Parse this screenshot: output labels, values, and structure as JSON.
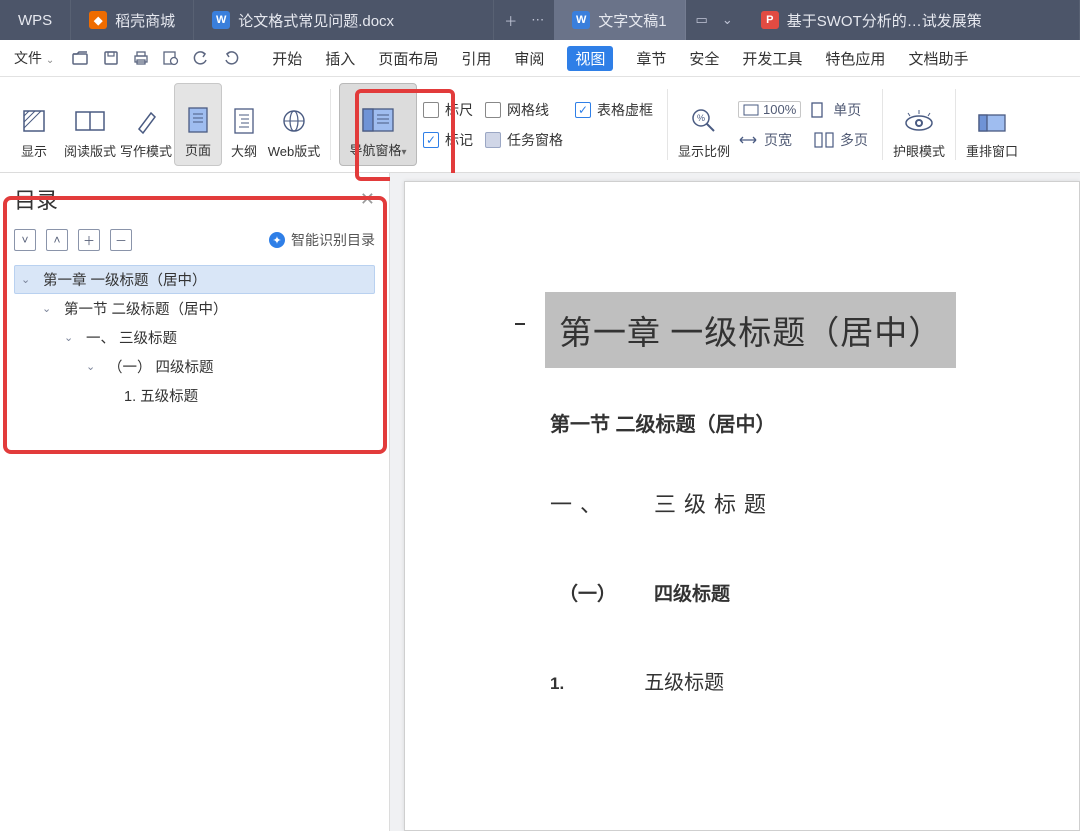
{
  "tabs": {
    "wps": "WPS",
    "mall": "稻壳商城",
    "doc1": "论文格式常见问题.docx",
    "doc2": "文字文稿1",
    "doc3": "基于SWOT分析的…试发展策"
  },
  "menubar": {
    "file": "文件",
    "items": [
      "开始",
      "插入",
      "页面布局",
      "引用",
      "审阅",
      "视图",
      "章节",
      "安全",
      "开发工具",
      "特色应用",
      "文档助手"
    ],
    "active": "视图"
  },
  "ribbon": {
    "display": "显示",
    "read": "阅读版式",
    "write": "写作模式",
    "page": "页面",
    "outline": "大纲",
    "web": "Web版式",
    "navpane": "导航窗格",
    "cb_ruler": "标尺",
    "cb_mark": "标记",
    "cb_grid": "网格线",
    "cb_taskpane": "任务窗格",
    "cb_tabledash": "表格虚框",
    "zoom": "显示比例",
    "pct": "100%",
    "single": "单页",
    "pagewidth": "页宽",
    "multi": "多页",
    "eyecare": "护眼模式",
    "rearrange": "重排窗口"
  },
  "navpane": {
    "title": "目录",
    "smart": "智能识别目录",
    "items": [
      "第一章  一级标题（居中）",
      "第一节  二级标题（居中）",
      "一、    三级标题",
      "（一）   四级标题",
      "1.         五级标题"
    ]
  },
  "document": {
    "h1": "第一章  一级标题（居中）",
    "h2": "第一节  二级标题（居中）",
    "h3a": "一、",
    "h3b": "三级标题",
    "h4a": "（一）",
    "h4b": "四级标题",
    "h5a": "1.",
    "h5b": "五级标题"
  }
}
